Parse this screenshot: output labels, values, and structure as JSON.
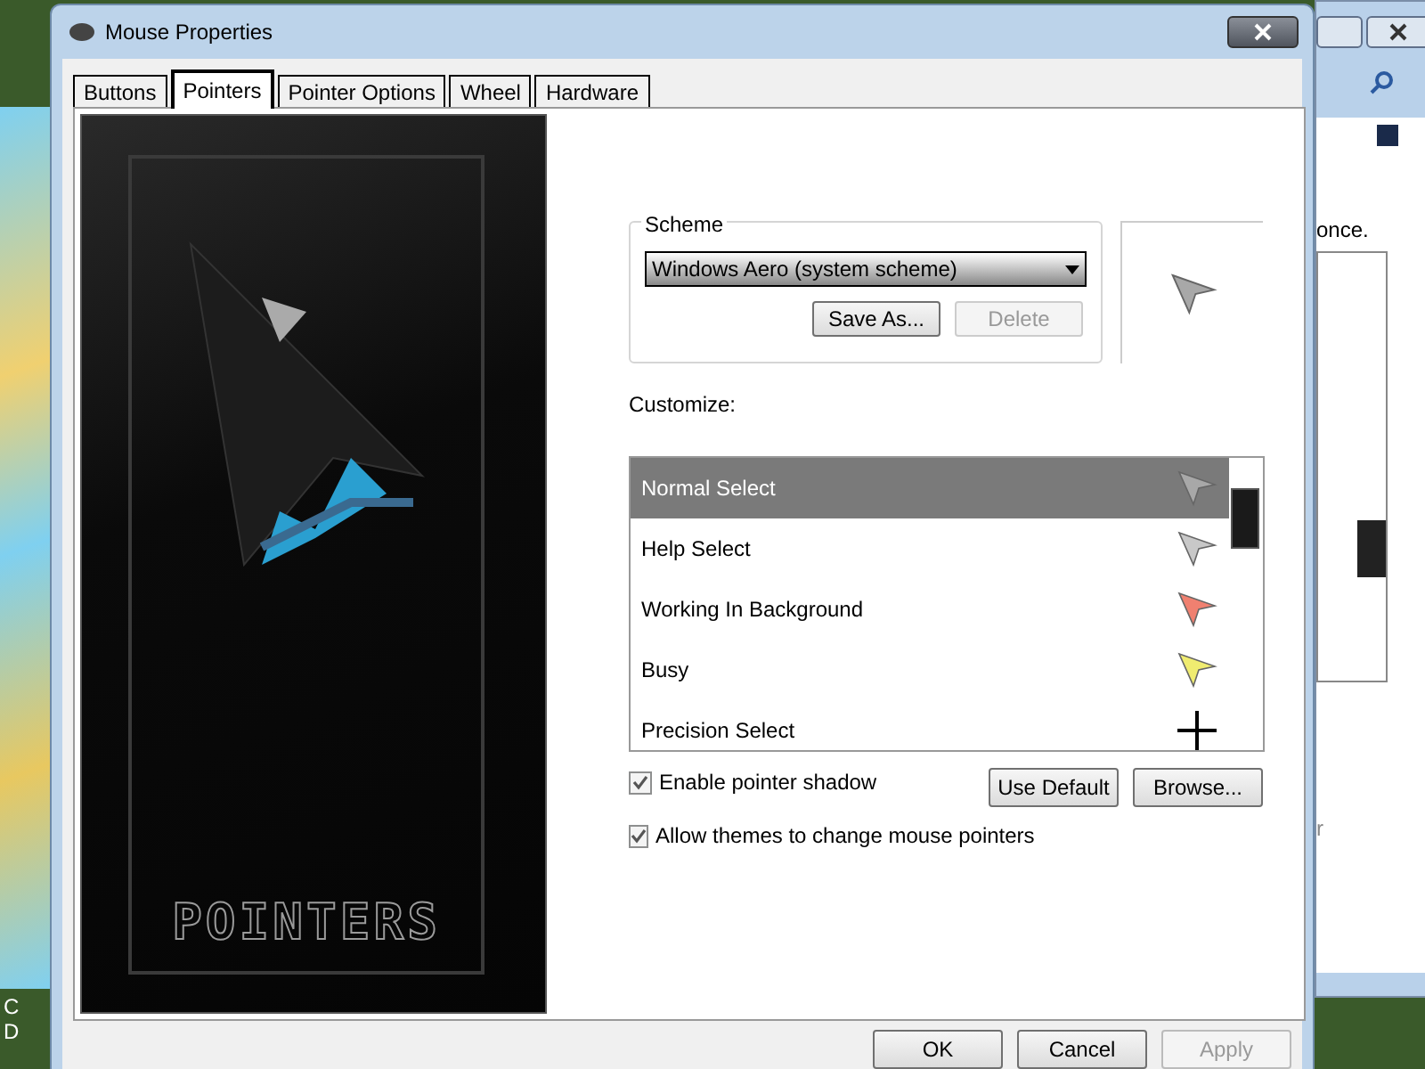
{
  "background": {
    "left_text": [
      "C",
      "D"
    ],
    "right_window": {
      "text": "once.",
      "fragment": "r"
    }
  },
  "window": {
    "title": "Mouse Properties"
  },
  "tabs": [
    {
      "label": "Buttons",
      "selected": false
    },
    {
      "label": "Pointers",
      "selected": true
    },
    {
      "label": "Pointer Options",
      "selected": false
    },
    {
      "label": "Wheel",
      "selected": false
    },
    {
      "label": "Hardware",
      "selected": false
    }
  ],
  "artwork": {
    "caption": "POINTERS"
  },
  "scheme": {
    "label": "Scheme",
    "value": "Windows Aero (system scheme)",
    "buttons": [
      {
        "label": "Save As...",
        "disabled": false
      },
      {
        "label": "Delete",
        "disabled": true
      }
    ]
  },
  "customize": {
    "label": "Customize:",
    "items": [
      {
        "name": "Normal Select",
        "selected": true,
        "kind": "arrow",
        "color": "#a8a8a8"
      },
      {
        "name": "Help Select",
        "selected": false,
        "kind": "arrow",
        "color": "#c8c8c8"
      },
      {
        "name": "Working In Background",
        "selected": false,
        "kind": "arrow",
        "color": "#f08070"
      },
      {
        "name": "Busy",
        "selected": false,
        "kind": "arrow",
        "color": "#f0ec70"
      },
      {
        "name": "Precision Select",
        "selected": false,
        "kind": "crosshair",
        "color": "#000000"
      }
    ]
  },
  "options": [
    {
      "label": "Enable pointer shadow",
      "checked": true
    },
    {
      "label": "Allow themes to change mouse pointers",
      "checked": true
    }
  ],
  "pointer_buttons": [
    {
      "label": "Use Default"
    },
    {
      "label": "Browse..."
    }
  ],
  "dialog_buttons": [
    {
      "label": "OK",
      "disabled": false
    },
    {
      "label": "Cancel",
      "disabled": false
    },
    {
      "label": "Apply",
      "disabled": true
    }
  ]
}
